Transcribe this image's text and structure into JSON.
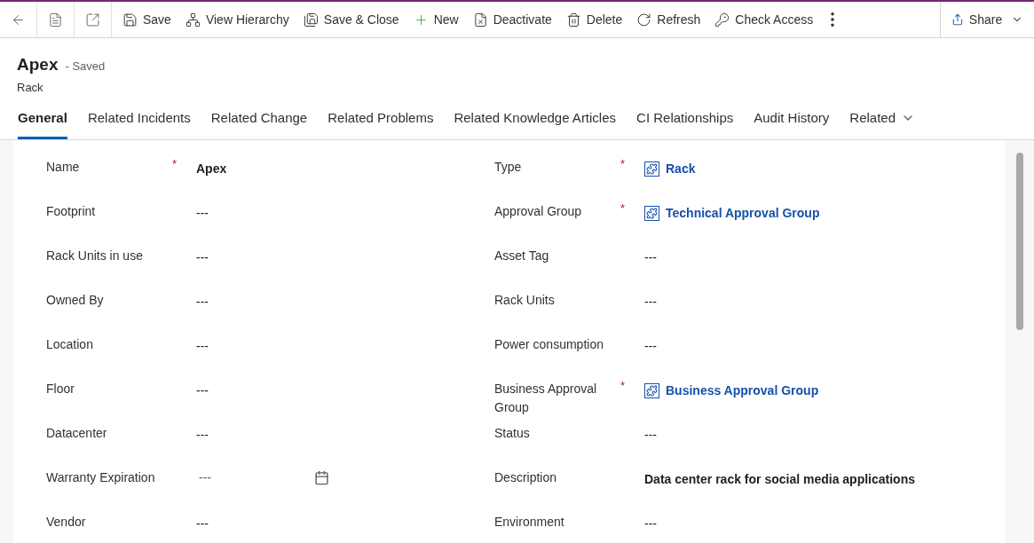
{
  "toolbar": {
    "nav": [
      {
        "kind": "back"
      },
      {
        "kind": "form"
      },
      {
        "kind": "popout"
      }
    ],
    "buttons": [
      {
        "kind": "save",
        "label": "Save"
      },
      {
        "kind": "hierarchy",
        "label": "View Hierarchy"
      },
      {
        "kind": "saveclose",
        "label": "Save & Close"
      },
      {
        "kind": "new",
        "label": "New"
      },
      {
        "kind": "deactivate",
        "label": "Deactivate"
      },
      {
        "kind": "delete",
        "label": "Delete"
      },
      {
        "kind": "refresh",
        "label": "Refresh"
      },
      {
        "kind": "access",
        "label": "Check Access"
      }
    ],
    "share": {
      "label": "Share"
    }
  },
  "record": {
    "title": "Apex",
    "status": "- Saved",
    "entity": "Rack"
  },
  "tabs": [
    {
      "label": "General",
      "selected": true,
      "dropdown": false
    },
    {
      "label": "Related Incidents",
      "selected": false,
      "dropdown": false
    },
    {
      "label": "Related Change",
      "selected": false,
      "dropdown": false
    },
    {
      "label": "Related Problems",
      "selected": false,
      "dropdown": false
    },
    {
      "label": "Related Knowledge Articles",
      "selected": false,
      "dropdown": false
    },
    {
      "label": "CI Relationships",
      "selected": false,
      "dropdown": false
    },
    {
      "label": "Audit History",
      "selected": false,
      "dropdown": false
    },
    {
      "label": "Related",
      "selected": false,
      "dropdown": true
    }
  ],
  "left_fields": [
    {
      "label": "Name",
      "required_mark": "*",
      "kind": "text",
      "bold": true,
      "value": "Apex"
    },
    {
      "label": "Footprint",
      "kind": "text",
      "bold": false,
      "value": "---"
    },
    {
      "label": "Rack Units in use",
      "kind": "text",
      "bold": false,
      "value": "---"
    },
    {
      "label": "Owned By",
      "kind": "text",
      "bold": false,
      "value": "---"
    },
    {
      "label": "Location",
      "kind": "text",
      "bold": false,
      "value": "---"
    },
    {
      "label": "Floor",
      "kind": "text",
      "bold": false,
      "value": "---"
    },
    {
      "label": "Datacenter",
      "kind": "text",
      "bold": false,
      "value": "---"
    },
    {
      "label": "Warranty Expiration",
      "kind": "date",
      "value": "---"
    },
    {
      "label": "Vendor",
      "kind": "text",
      "bold": false,
      "value": "---"
    }
  ],
  "right_fields": [
    {
      "label": "Type",
      "required_mark": "*",
      "kind": "lookup",
      "value": "Rack"
    },
    {
      "label": "Approval Group",
      "required_mark": "*",
      "kind": "lookup",
      "value": "Technical Approval Group"
    },
    {
      "label": "Asset Tag",
      "kind": "text",
      "bold": false,
      "value": "---"
    },
    {
      "label": "Rack Units",
      "kind": "text",
      "bold": false,
      "value": "---"
    },
    {
      "label": "Power consumption",
      "kind": "text",
      "bold": false,
      "value": "---"
    },
    {
      "label": "Business Approval Group",
      "required_mark": "*",
      "kind": "lookup",
      "value": "Business Approval Group"
    },
    {
      "label": "Status",
      "kind": "text",
      "bold": false,
      "value": "---"
    },
    {
      "label": "Description",
      "kind": "text",
      "bold": true,
      "value": "Data center rack for social media applications"
    },
    {
      "label": "Environment",
      "kind": "text",
      "bold": false,
      "value": "---"
    }
  ]
}
